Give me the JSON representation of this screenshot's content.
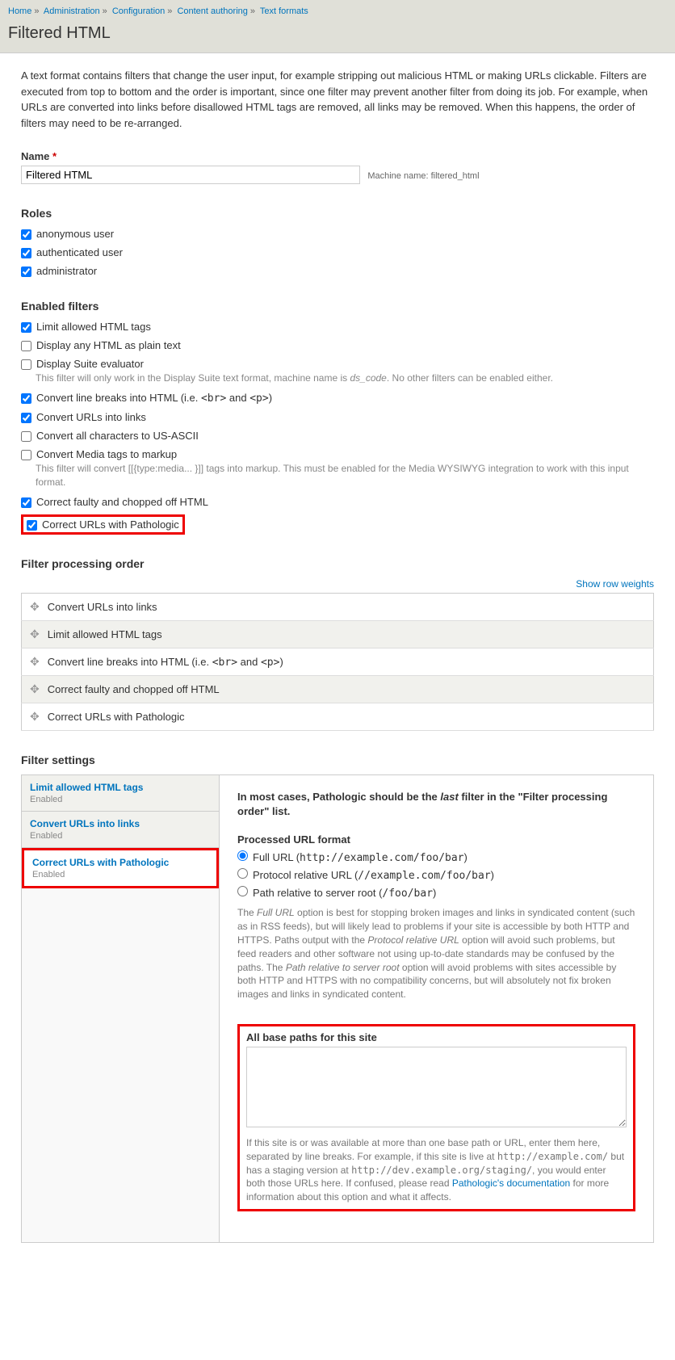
{
  "breadcrumb": [
    "Home",
    "Administration",
    "Configuration",
    "Content authoring",
    "Text formats"
  ],
  "page_title": "Filtered HTML",
  "intro": "A text format contains filters that change the user input, for example stripping out malicious HTML or making URLs clickable. Filters are executed from top to bottom and the order is important, since one filter may prevent another filter from doing its job. For example, when URLs are converted into links before disallowed HTML tags are removed, all links may be removed. When this happens, the order of filters may need to be re-arranged.",
  "name_label": "Name",
  "name_value": "Filtered HTML",
  "machine_name": "Machine name: filtered_html",
  "roles_heading": "Roles",
  "roles": [
    {
      "label": "anonymous user",
      "checked": true
    },
    {
      "label": "authenticated user",
      "checked": true
    },
    {
      "label": "administrator",
      "checked": true
    }
  ],
  "enabled_heading": "Enabled filters",
  "filters": {
    "limit": {
      "label": "Limit allowed HTML tags",
      "checked": true
    },
    "plain": {
      "label": "Display any HTML as plain text",
      "checked": false
    },
    "ds": {
      "label": "Display Suite evaluator",
      "checked": false,
      "desc_a": "This filter will only work in the Display Suite text format, machine name is ",
      "desc_em": "ds_code",
      "desc_b": ". No other filters can be enabled either."
    },
    "br": {
      "label_a": "Convert line breaks into HTML (i.e. ",
      "label_m": "<br>",
      "label_mid": " and ",
      "label_m2": "<p>",
      "label_b": ")",
      "checked": true
    },
    "urls": {
      "label": "Convert URLs into links",
      "checked": true
    },
    "ascii": {
      "label": "Convert all characters to US-ASCII",
      "checked": false
    },
    "media": {
      "label": "Convert Media tags to markup",
      "checked": false,
      "desc": "This filter will convert [[{type:media... }]] tags into markup. This must be enabled for the Media WYSIWYG integration to work with this input format."
    },
    "correct": {
      "label": "Correct faulty and chopped off HTML",
      "checked": true
    },
    "pathologic": {
      "label": "Correct URLs with Pathologic",
      "checked": true
    }
  },
  "order_heading": "Filter processing order",
  "show_weights": "Show row weights",
  "order_rows": [
    {
      "label_a": "Convert URLs into links"
    },
    {
      "label_a": "Limit allowed HTML tags"
    },
    {
      "label_a": "Convert line breaks into HTML (i.e. ",
      "mono1": "<br>",
      "mid": " and ",
      "mono2": "<p>",
      "label_b": ")"
    },
    {
      "label_a": "Correct faulty and chopped off HTML"
    },
    {
      "label_a": "Correct URLs with Pathologic"
    }
  ],
  "settings_heading": "Filter settings",
  "tabs": [
    {
      "title": "Limit allowed HTML tags",
      "sub": "Enabled"
    },
    {
      "title": "Convert URLs into links",
      "sub": "Enabled"
    },
    {
      "title": "Correct URLs with Pathologic",
      "sub": "Enabled"
    }
  ],
  "pathologic": {
    "note_a": "In most cases, Pathologic should be the ",
    "note_em": "last",
    "note_b": " filter in the \"Filter processing order\" list.",
    "fmt_heading": "Processed URL format",
    "opt_full_a": "Full URL (",
    "opt_full_m": "http://example.com/foo/bar",
    "opt_full_b": ")",
    "opt_proto_a": "Protocol relative URL (",
    "opt_proto_m": "//example.com/foo/bar",
    "opt_proto_b": ")",
    "opt_path_a": "Path relative to server root (",
    "opt_path_m": "/foo/bar",
    "opt_path_b": ")",
    "help_a": "The ",
    "help_em1": "Full URL",
    "help_b": " option is best for stopping broken images and links in syndicated content (such as in RSS feeds), but will likely lead to problems if your site is accessible by both HTTP and HTTPS. Paths output with the ",
    "help_em2": "Protocol relative URL",
    "help_c": " option will avoid such problems, but feed readers and other software not using up-to-date standards may be confused by the paths. The ",
    "help_em3": "Path relative to server root",
    "help_d": " option will avoid problems with sites accessible by both HTTP and HTTPS with no compatibility concerns, but will absolutely not fix broken images and links in syndicated content.",
    "base_label": "All base paths for this site",
    "base_help_a": "If this site is or was available at more than one base path or URL, enter them here, separated by line breaks. For example, if this site is live at ",
    "base_m1": "http://example.com/",
    "base_help_b": " but has a staging version at ",
    "base_m2": "http://dev.example.org/staging/",
    "base_help_c": ", you would enter both those URLs here. If confused, please read ",
    "base_link": "Pathologic's documentation",
    "base_help_d": " for more information about this option and what it affects."
  }
}
